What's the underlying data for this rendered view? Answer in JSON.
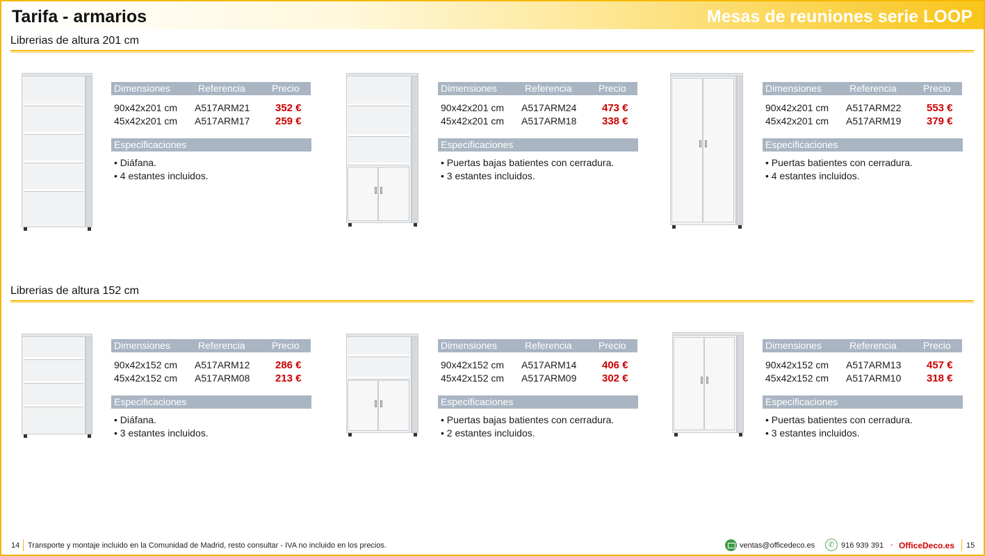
{
  "header": {
    "title": "Tarifa - armarios",
    "series": "Mesas de reuniones serie LOOP"
  },
  "table_headers": {
    "dimensions": "Dimensiones",
    "reference": "Referencia",
    "price": "Precio",
    "specs": "Especificaciones"
  },
  "sections": [
    {
      "title": "Librerias de altura 201 cm",
      "products": [
        {
          "rows": [
            {
              "dim": "90x42x201 cm",
              "ref": "A517ARM21",
              "price": "352 €"
            },
            {
              "dim": "45x42x201 cm",
              "ref": "A517ARM17",
              "price": "259 €"
            }
          ],
          "specs": [
            "• Diáfana.",
            "• 4 estantes incluidos."
          ]
        },
        {
          "rows": [
            {
              "dim": "90x42x201 cm",
              "ref": "A517ARM24",
              "price": "473 €"
            },
            {
              "dim": "45x42x201 cm",
              "ref": "A517ARM18",
              "price": "338 €"
            }
          ],
          "specs": [
            "• Puertas bajas batientes con cerradura.",
            "• 3 estantes incluidos."
          ]
        },
        {
          "rows": [
            {
              "dim": "90x42x201 cm",
              "ref": "A517ARM22",
              "price": "553 €"
            },
            {
              "dim": "45x42x201 cm",
              "ref": "A517ARM19",
              "price": "379 €"
            }
          ],
          "specs": [
            "• Puertas batientes con cerradura.",
            "• 4 estantes incluidos."
          ]
        }
      ]
    },
    {
      "title": "Librerias de altura 152 cm",
      "products": [
        {
          "rows": [
            {
              "dim": "90x42x152 cm",
              "ref": "A517ARM12",
              "price": "286 €"
            },
            {
              "dim": "45x42x152 cm",
              "ref": "A517ARM08",
              "price": "213 €"
            }
          ],
          "specs": [
            "• Diáfana.",
            "• 3 estantes incluidos."
          ]
        },
        {
          "rows": [
            {
              "dim": "90x42x152 cm",
              "ref": "A517ARM14",
              "price": "406 €"
            },
            {
              "dim": "45x42x152 cm",
              "ref": "A517ARM09",
              "price": "302 €"
            }
          ],
          "specs": [
            "• Puertas bajas batientes con cerradura.",
            "• 2 estantes incluidos."
          ]
        },
        {
          "rows": [
            {
              "dim": "90x42x152 cm",
              "ref": "A517ARM13",
              "price": "457 €"
            },
            {
              "dim": "45x42x152 cm",
              "ref": "A517ARM10",
              "price": "318 €"
            }
          ],
          "specs": [
            "• Puertas batientes con cerradura.",
            "• 3 estantes incluidos."
          ]
        }
      ]
    }
  ],
  "footer": {
    "page_left": "14",
    "disclaimer": "Transporte y montaje incluido en la Comunidad de Madrid, resto consultar - IVA no incluido en los precios.",
    "email": "ventas@officedeco.es",
    "phone": "916 939 391",
    "separator": "-",
    "brand": "OfficeDeco.es",
    "page_right": "15",
    "email_icon": "email-icon",
    "phone_icon": "phone-icon"
  },
  "colors": {
    "accent": "#f5b800",
    "table_header": "#a9b5c2",
    "price": "#cc0000"
  }
}
